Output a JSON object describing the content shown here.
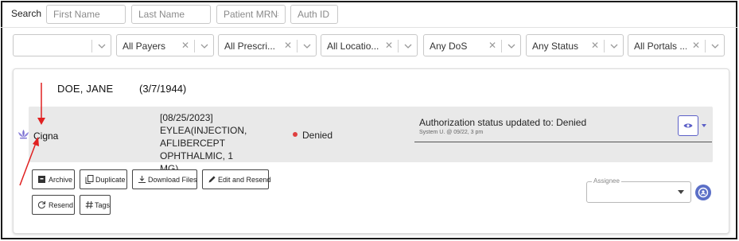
{
  "search": {
    "label": "Search",
    "first_name_placeholder": "First Name",
    "last_name_placeholder": "Last Name",
    "mrn_placeholder": "Patient MRN#",
    "auth_id_placeholder": "Auth ID"
  },
  "filters": [
    {
      "label": ""
    },
    {
      "label": "All Payers"
    },
    {
      "label": "All Prescri..."
    },
    {
      "label": "All Locatio..."
    },
    {
      "label": "Any DoS"
    },
    {
      "label": "Any Status"
    },
    {
      "label": "All Portals ..."
    }
  ],
  "patient": {
    "name": "DOE, JANE",
    "dob": "(3/7/1944)"
  },
  "auth": {
    "payer": "Cigna",
    "date": "[08/25/2023]",
    "drug_line1": "EYLEA(INJECTION,",
    "drug_line2": "AFLIBERCEPT OPHTHALMIC, 1",
    "drug_line3": "MG)",
    "status": "Denied",
    "status_color": "#e04040",
    "update_text": "Authorization status updated to: Denied",
    "update_meta": "System U. @ 09/22, 3 pm"
  },
  "actions": {
    "archive": "Archive",
    "duplicate": "Duplicate",
    "download": "Download Files",
    "edit_resend": "Edit and Resend",
    "resend": "Resend",
    "tags": "Tags"
  },
  "assignee": {
    "label": "Assignee"
  },
  "colors": {
    "accent": "#5b5fc7",
    "annotation_arrow": "#e02020"
  }
}
